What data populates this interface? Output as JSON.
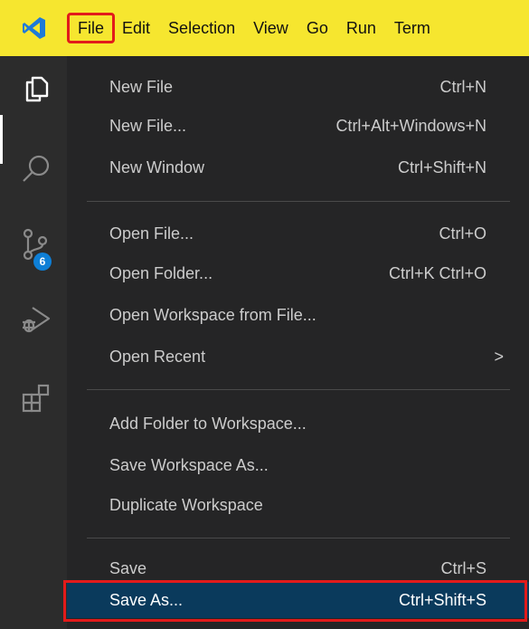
{
  "menubar": {
    "items": [
      "File",
      "Edit",
      "Selection",
      "View",
      "Go",
      "Run",
      "Term"
    ],
    "highlight_color": "#e21b1b",
    "background": "#f6e62f"
  },
  "activity": {
    "icons": [
      "explorer-icon",
      "search-icon",
      "source-control-icon",
      "run-debug-icon",
      "extensions-icon"
    ],
    "scm_badge": "6"
  },
  "file_menu": {
    "group1": [
      {
        "label": "New File",
        "shortcut": "Ctrl+N"
      },
      {
        "label": "New File...",
        "shortcut": "Ctrl+Alt+Windows+N"
      },
      {
        "label": "New Window",
        "shortcut": "Ctrl+Shift+N"
      }
    ],
    "group2": [
      {
        "label": "Open File...",
        "shortcut": "Ctrl+O"
      },
      {
        "label": "Open Folder...",
        "shortcut": "Ctrl+K Ctrl+O"
      },
      {
        "label": "Open Workspace from File...",
        "shortcut": ""
      },
      {
        "label": "Open Recent",
        "shortcut": ""
      }
    ],
    "group3": [
      {
        "label": "Add Folder to Workspace...",
        "shortcut": ""
      },
      {
        "label": "Save Workspace As...",
        "shortcut": ""
      },
      {
        "label": "Duplicate Workspace",
        "shortcut": ""
      }
    ],
    "group4": [
      {
        "label": "Save",
        "shortcut": "Ctrl+S"
      },
      {
        "label": "Save As...",
        "shortcut": "Ctrl+Shift+S"
      }
    ],
    "submenu_arrow": ">",
    "selected_item": "Save As..."
  }
}
